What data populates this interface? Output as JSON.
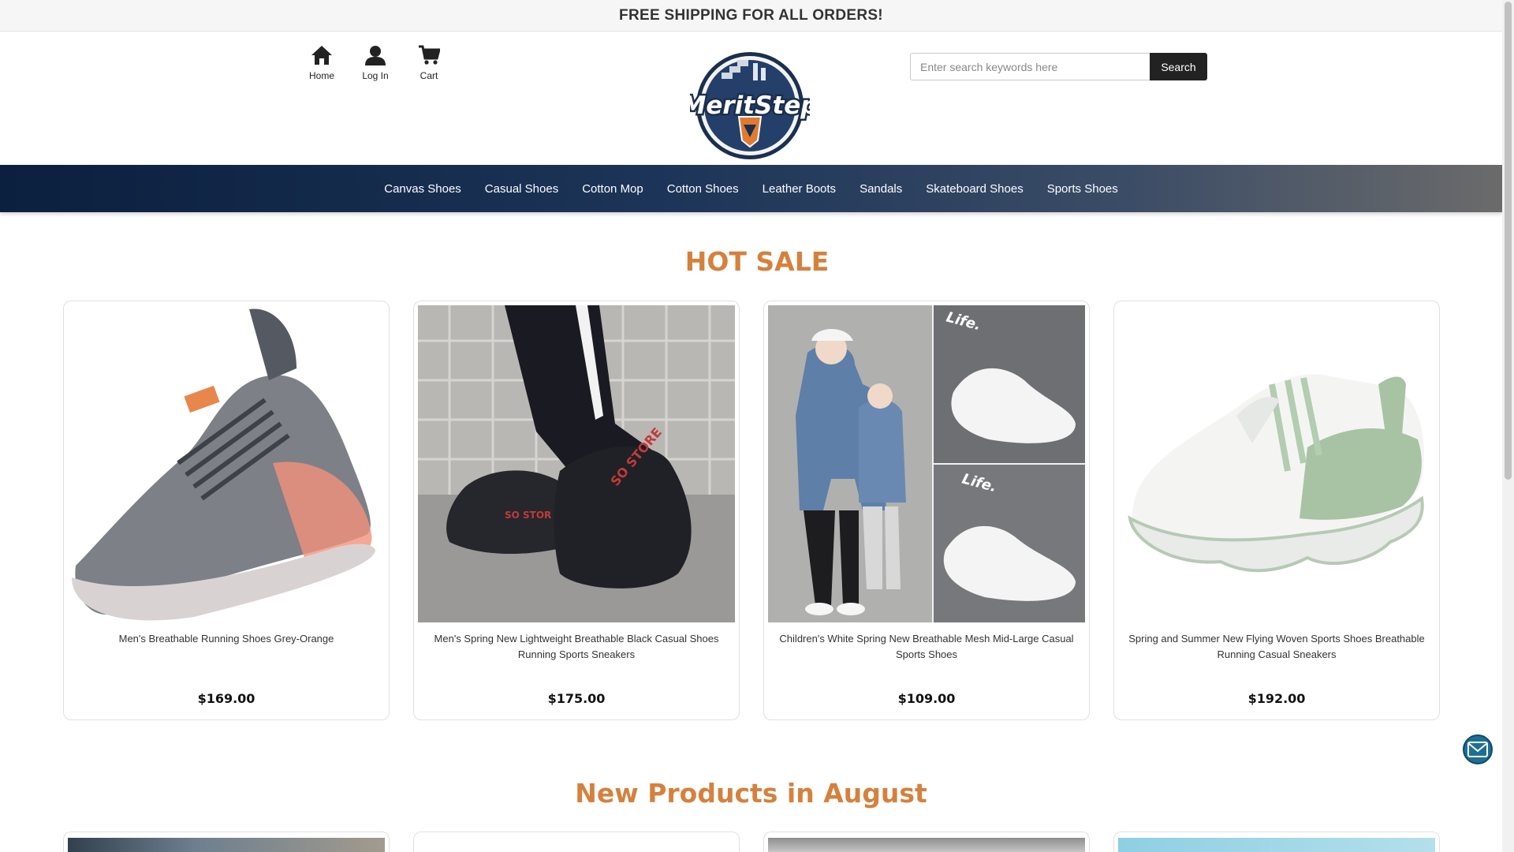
{
  "topbar": {
    "announcement": "FREE SHIPPING FOR ALL ORDERS!"
  },
  "header": {
    "quicklinks": [
      {
        "label": "Home",
        "icon": "home-icon"
      },
      {
        "label": "Log In",
        "icon": "user-icon"
      },
      {
        "label": "Cart",
        "icon": "cart-icon"
      }
    ],
    "logo_text": "MeritStep",
    "search": {
      "placeholder": "Enter search keywords here",
      "value": "",
      "button_label": "Search"
    }
  },
  "nav": {
    "items": [
      "Canvas Shoes",
      "Casual Shoes",
      "Cotton Mop",
      "Cotton Shoes",
      "Leather Boots",
      "Sandals",
      "Skateboard Shoes",
      "Sports Shoes"
    ]
  },
  "hot_sale": {
    "title": "HOT SALE",
    "products": [
      {
        "name": "Men's Breathable Running Shoes Grey-Orange",
        "price": "$169.00"
      },
      {
        "name": "Men's Spring New Lightweight Breathable Black Casual Shoes Running Sports Sneakers",
        "price": "$175.00"
      },
      {
        "name": "Children's White Spring New Breathable Mesh Mid-Large Casual Sports Shoes",
        "price": "$109.00"
      },
      {
        "name": "Spring and Summer New Flying Woven Sports Shoes Breathable Running Casual Sneakers",
        "price": "$192.00"
      }
    ]
  },
  "new_products": {
    "title": "New Products in August"
  },
  "colors": {
    "accent": "#d5813e",
    "nav_dark": "#0b1f3e",
    "button": "#222222",
    "mail": "#1e6f93"
  }
}
